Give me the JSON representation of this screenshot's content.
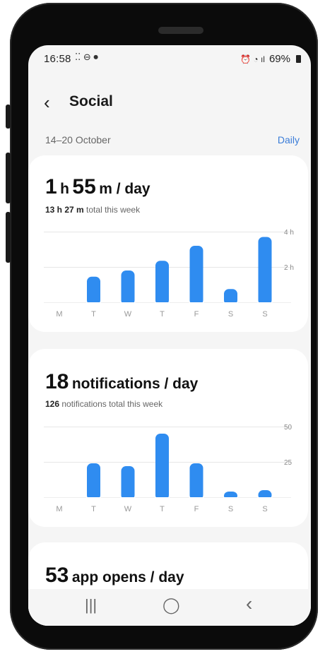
{
  "status": {
    "time": "16:58",
    "left_icons": "⁚⁚ ⊖ ⏺",
    "right_icons": "⏰ ◔ ıl",
    "battery": "69%"
  },
  "header": {
    "title": "Social"
  },
  "date_row": {
    "range": "14–20 October",
    "mode": "Daily"
  },
  "screen_time": {
    "value": "1",
    "unit1": "h",
    "value2": "55",
    "unit2": "m / day",
    "total_bold": "13 h 27 m",
    "total_text": "total this week",
    "chart_data": {
      "type": "bar",
      "categories": [
        "M",
        "T",
        "W",
        "T",
        "F",
        "S",
        "S"
      ],
      "values": [
        0,
        1.45,
        1.8,
        2.35,
        3.2,
        0.75,
        3.7
      ],
      "y_ticks": [
        "4 h",
        "2 h"
      ],
      "ylim": [
        0,
        4
      ],
      "color": "#2f8cf0"
    }
  },
  "notifications": {
    "value": "18",
    "unit": "notifications / day",
    "total_bold": "126",
    "total_text": "notifications total this week",
    "chart_data": {
      "type": "bar",
      "categories": [
        "M",
        "T",
        "W",
        "T",
        "F",
        "S",
        "S"
      ],
      "values": [
        0,
        24,
        22,
        45,
        24,
        4,
        5
      ],
      "y_ticks": [
        "50",
        "25"
      ],
      "ylim": [
        0,
        50
      ],
      "color": "#2f8cf0"
    }
  },
  "app_opens": {
    "value": "53",
    "unit": "app opens / day"
  },
  "nav": {
    "recents": "|||",
    "home": "◯",
    "back": "‹"
  }
}
